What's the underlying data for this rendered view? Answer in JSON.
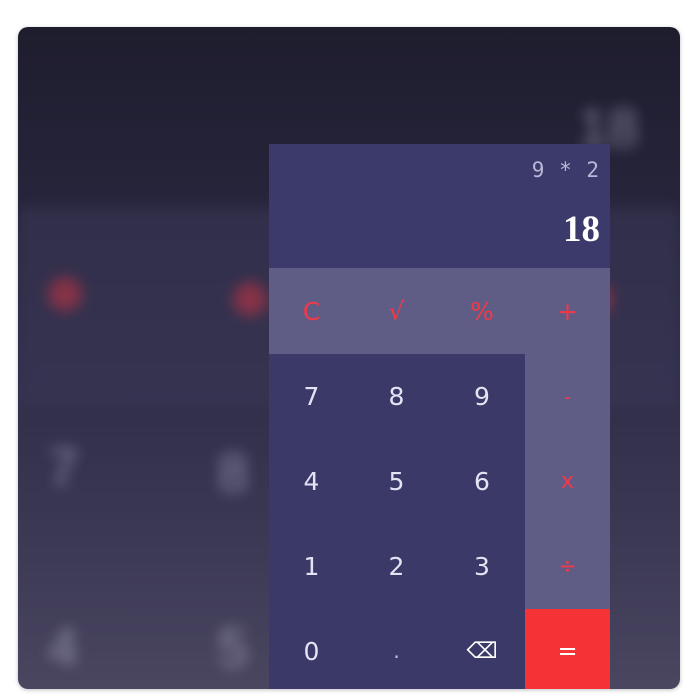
{
  "display": {
    "expression": "9 * 2",
    "result": "18"
  },
  "keys": {
    "clear": "C",
    "sqrt": "√",
    "percent": "%",
    "plus": "+",
    "seven": "7",
    "eight": "8",
    "nine": "9",
    "minus": "-",
    "four": "4",
    "five": "5",
    "six": "6",
    "multiply": "x",
    "one": "1",
    "two": "2",
    "three": "3",
    "divide": "÷",
    "zero": "0",
    "dot": ".",
    "backspace": "⌫",
    "equals": "="
  },
  "colors": {
    "display_bg": "#3b3a6a",
    "operator_bg": "#5f5d86",
    "keypad_bg": "#3a3968",
    "operator_text": "#f0394a",
    "equals_bg": "#f53337"
  }
}
